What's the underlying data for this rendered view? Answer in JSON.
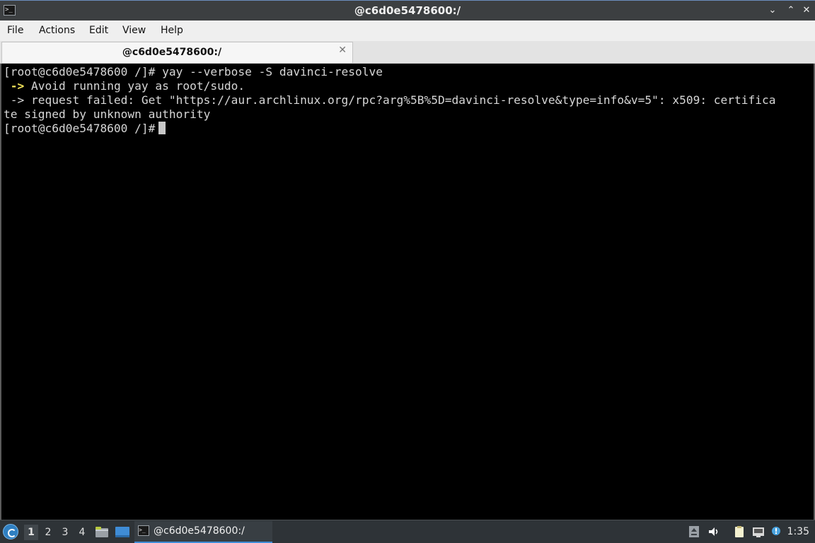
{
  "window": {
    "title": "@c6d0e5478600:/",
    "minimize_glyph": "⌄",
    "maximize_glyph": "⌃",
    "close_glyph": "✕"
  },
  "menu": {
    "items": [
      "File",
      "Actions",
      "Edit",
      "View",
      "Help"
    ]
  },
  "tab": {
    "label": "@c6d0e5478600:/",
    "close_glyph": "✕"
  },
  "terminal": {
    "lines": [
      {
        "prefix": "",
        "text": "[root@c6d0e5478600 /]# yay --verbose -S davinci-resolve"
      },
      {
        "prefix": " ->",
        "text": " Avoid running yay as root/sudo."
      },
      {
        "prefix": "",
        "text": " -> request failed: Get \"https://aur.archlinux.org/rpc?arg%5B%5D=davinci-resolve&type=info&v=5\": x509: certifica"
      },
      {
        "prefix": "",
        "text": "te signed by unknown authority"
      },
      {
        "prefix": "",
        "text": "[root@c6d0e5478600 /]#"
      }
    ],
    "colors": {
      "background": "#000000",
      "text": "#d6d6d6",
      "arrow": "#f3e35a"
    }
  },
  "taskbar": {
    "workspaces": [
      "1",
      "2",
      "3",
      "4"
    ],
    "active_workspace": "1",
    "task_label": "@c6d0e5478600:/",
    "clock": "1:35",
    "icons": [
      "start-menu-icon",
      "file-manager-icon",
      "show-desktop-icon",
      "terminal-icon",
      "upload-icon",
      "volume-icon",
      "clipboard-icon",
      "network-icon",
      "notification-icon"
    ]
  }
}
